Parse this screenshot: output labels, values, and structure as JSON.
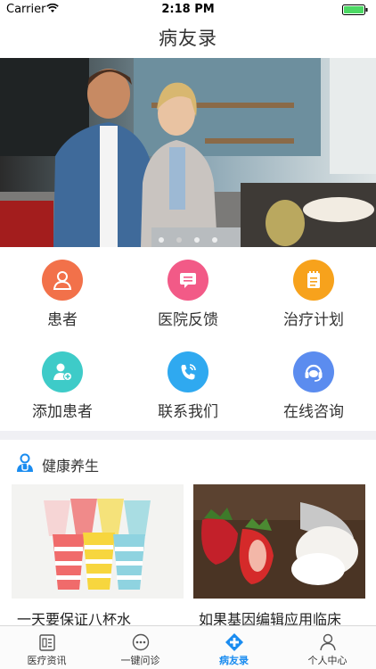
{
  "status_bar": {
    "carrier": "Carrier",
    "time": "2:18 PM"
  },
  "nav": {
    "title": "病友录"
  },
  "banner": {
    "page_count": 4,
    "active_index": 1
  },
  "grid": {
    "items": [
      {
        "label": "患者",
        "icon": "patient-icon",
        "color": "#f2714a"
      },
      {
        "label": "医院反馈",
        "icon": "feedback-icon",
        "color": "#f25a87"
      },
      {
        "label": "治疗计划",
        "icon": "plan-icon",
        "color": "#f7a21c"
      },
      {
        "label": "添加患者",
        "icon": "add-patient-icon",
        "color": "#3ecbc8"
      },
      {
        "label": "联系我们",
        "icon": "phone-icon",
        "color": "#2fa9f0"
      },
      {
        "label": "在线咨询",
        "icon": "headset-icon",
        "color": "#5b8cef"
      }
    ]
  },
  "health": {
    "title": "健康养生",
    "articles": [
      {
        "title": "一天要保证八杯水"
      },
      {
        "title": "如果基因编辑应用临床"
      }
    ]
  },
  "tabs": [
    {
      "label": "医疗资讯",
      "icon": "news-icon"
    },
    {
      "label": "一键问诊",
      "icon": "chat-icon"
    },
    {
      "label": "病友录",
      "icon": "plus-diamond-icon",
      "active": true
    },
    {
      "label": "个人中心",
      "icon": "person-icon"
    }
  ],
  "colors": {
    "accent": "#1a8cf0"
  }
}
